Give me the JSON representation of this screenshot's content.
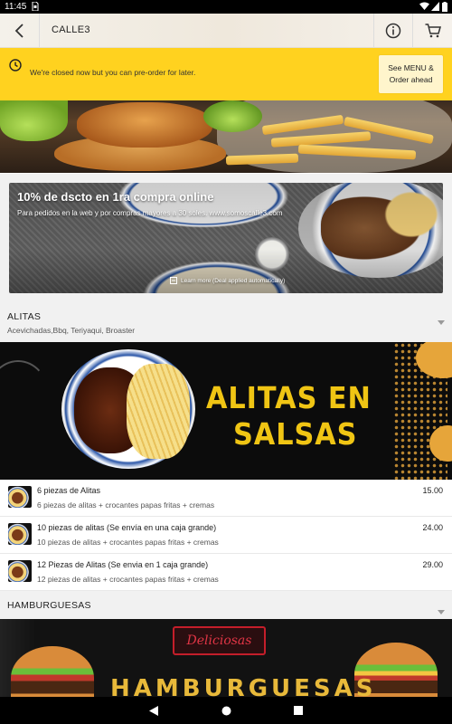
{
  "status_bar": {
    "time": "11:45",
    "icons": [
      "sim-card-icon",
      "wifi-icon",
      "signal-icon",
      "battery-icon"
    ]
  },
  "app_bar": {
    "title": "CALLE3",
    "back_icon": "chevron-left-icon",
    "info_icon": "info-icon",
    "cart_icon": "cart-icon"
  },
  "closed_banner": {
    "icon": "clock-icon",
    "message": "We're closed now but you can pre-order for later.",
    "cta_line1": "See MENU &",
    "cta_line2": "Order ahead"
  },
  "promo": {
    "title": "10% de dscto en 1ra compra online",
    "subtitle": "Para pedidos en la web y por compras mayores a 30 soles. www.somoscalle3.com",
    "learn_more": "Learn more (Deal applied automatically)"
  },
  "sections": [
    {
      "name": "ALITAS",
      "description": "Acevichadas,Bbq, Teriyaqui, Broaster",
      "banner_line1": "ALITAS EN",
      "banner_line2": "SALSAS",
      "items": [
        {
          "name": "6 piezas de Alitas",
          "description": "6 piezas de alitas + crocantes papas fritas + cremas",
          "price": "15.00"
        },
        {
          "name": "10 piezas de alitas (Se envía en una caja grande)",
          "description": "10 piezas de alitas + crocantes papas fritas + cremas",
          "price": "24.00"
        },
        {
          "name": "12 Piezas de Alitas (Se envia en 1 caja grande)",
          "description": "12 piezas de alitas + crocantes papas fritas + cremas",
          "price": "29.00"
        }
      ]
    },
    {
      "name": "HAMBURGUESAS",
      "banner_badge": "Deliciosas",
      "banner_title": "HAMBURGUESAS"
    }
  ],
  "colors": {
    "accent_yellow": "#ffd21f",
    "banner_gold": "#f0c514",
    "section_bg": "#f1f1f1",
    "badge_red": "#c41e2a"
  },
  "nav_bar": {
    "icons": [
      "back-triangle-icon",
      "home-circle-icon",
      "recents-square-icon"
    ]
  }
}
